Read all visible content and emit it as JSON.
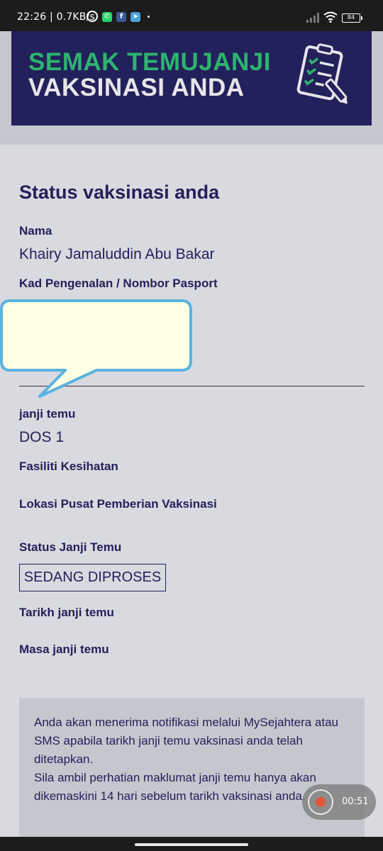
{
  "status_bar": {
    "time_info": "22:26 | 0.7KB/s",
    "battery": "84",
    "icons": [
      "alarm-icon",
      "whatsapp-icon",
      "facebook-icon",
      "telegram-icon",
      "signal-icon",
      "wifi-icon",
      "battery-icon"
    ]
  },
  "banner": {
    "line1": "SEMAK TEMUJANJI",
    "line2": "VAKSINASI ANDA",
    "icon": "clipboard-checklist-icon",
    "colors": {
      "background": "#22215b",
      "accent": "#2eb36e",
      "text": "#e6e6ea"
    }
  },
  "status": {
    "heading": "Status vaksinasi anda",
    "name_label": "Nama",
    "name_value": "Khairy Jamaluddin Abu Bakar",
    "id_label": "Kad Pengenalan / Nombor Pasport",
    "appointment_label": "janji temu",
    "appointment_value": "DOS 1",
    "facility_label": "Fasiliti Kesihatan",
    "location_label": "Lokasi Pusat Pemberian Vaksinasi",
    "appointment_status_label": "Status Janji Temu",
    "appointment_status_value": "SEDANG DIPROSES",
    "date_label": "Tarikh janji temu",
    "time_label": "Masa janji temu"
  },
  "notice": {
    "text": "Anda akan menerima notifikasi melalui MySejahtera atau SMS apabila tarikh janji temu vaksinasi anda telah ditetapkan.\nSila ambil perhatian maklumat janji temu hanya akan dikemaskini 14 hari sebelum tarikh vaksinasi anda."
  },
  "recorder": {
    "elapsed": "00:51"
  }
}
